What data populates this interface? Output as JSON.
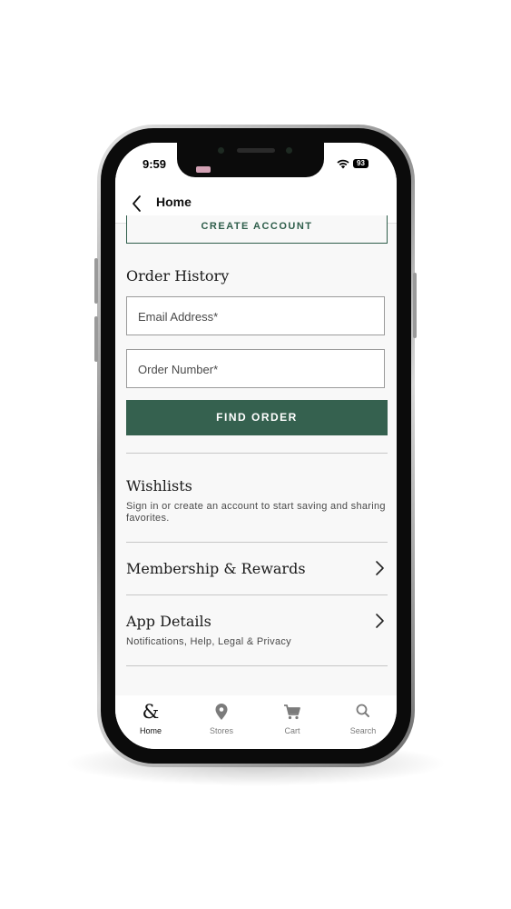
{
  "status_bar": {
    "time": "9:59",
    "battery": "93"
  },
  "nav": {
    "title": "Home"
  },
  "create_account": {
    "label": "CREATE ACCOUNT"
  },
  "order_history": {
    "title": "Order History",
    "email_placeholder": "Email Address*",
    "order_placeholder": "Order Number*",
    "find_button": "FIND ORDER"
  },
  "wishlists": {
    "title": "Wishlists",
    "description": "Sign in or create an account to start saving and sharing favorites."
  },
  "membership": {
    "title": "Membership & Rewards"
  },
  "app_details": {
    "title": "App Details",
    "subtitle": "Notifications, Help, Legal & Privacy"
  },
  "tabs": [
    {
      "label": "Home",
      "icon": "ampersand-icon",
      "active": true
    },
    {
      "label": "Stores",
      "icon": "location-pin-icon",
      "active": false
    },
    {
      "label": "Cart",
      "icon": "cart-icon",
      "active": false
    },
    {
      "label": "Search",
      "icon": "search-icon",
      "active": false
    }
  ],
  "colors": {
    "accent": "#35614f",
    "background": "#f8f8f8"
  }
}
